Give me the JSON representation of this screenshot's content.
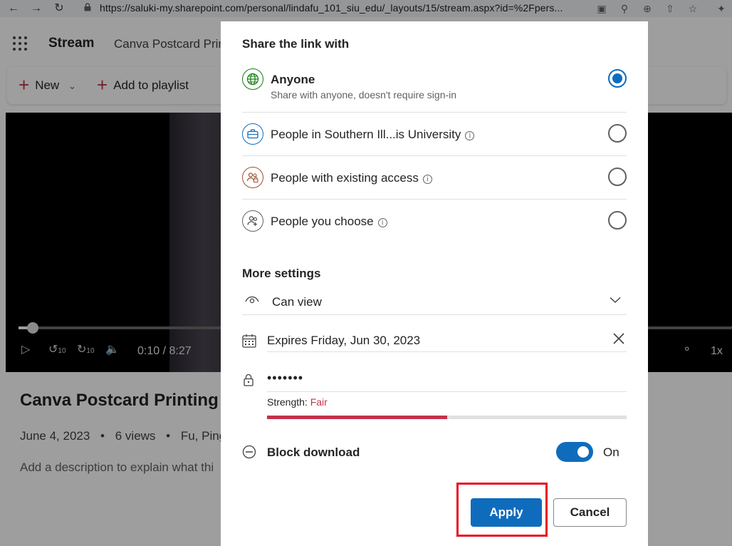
{
  "browser": {
    "url": "https://saluki-my.sharepoint.com/personal/lindafu_101_siu_edu/_layouts/15/stream.aspx?id=%2Fpers..."
  },
  "app": {
    "name": "Stream",
    "doc_title_truncated": "Canva Postcard Prin",
    "commands": {
      "new": "New",
      "add_to_playlist": "Add to playlist"
    },
    "player": {
      "time": "0:10 / 8:27",
      "speed": "1x",
      "skip_back": "10",
      "skip_fwd": "10"
    },
    "video_title_truncated": "Canva Postcard Printing i",
    "meta": {
      "date": "June 4, 2023",
      "views": "6 views",
      "author": "Fu, Pingp"
    },
    "description_placeholder": "Add a description to explain what thi"
  },
  "dialog": {
    "title": "Share the link with",
    "options": [
      {
        "label": "Anyone",
        "sub": "Share with anyone, doesn't require sign-in",
        "selected": true,
        "icon": "globe-icon"
      },
      {
        "label": "People in Southern Ill...is University",
        "selected": false,
        "icon": "briefcase-icon",
        "info": true
      },
      {
        "label": "People with existing access",
        "selected": false,
        "icon": "people-lock-icon",
        "info": true
      },
      {
        "label": "People you choose",
        "selected": false,
        "icon": "people-add-icon",
        "info": true
      }
    ],
    "info_glyph": "i",
    "more_settings_title": "More settings",
    "permission": "Can view",
    "expiration": "Expires Friday, Jun 30, 2023",
    "password_mask": "•••••••",
    "strength_label": "Strength:",
    "strength_value": "Fair",
    "strength_level": 0.5,
    "block_download_label": "Block download",
    "block_download_state": "On",
    "apply_label": "Apply",
    "cancel_label": "Cancel",
    "colors": {
      "accent": "#0f6cbd",
      "danger": "#c4314b",
      "highlight": "#e81123"
    }
  }
}
